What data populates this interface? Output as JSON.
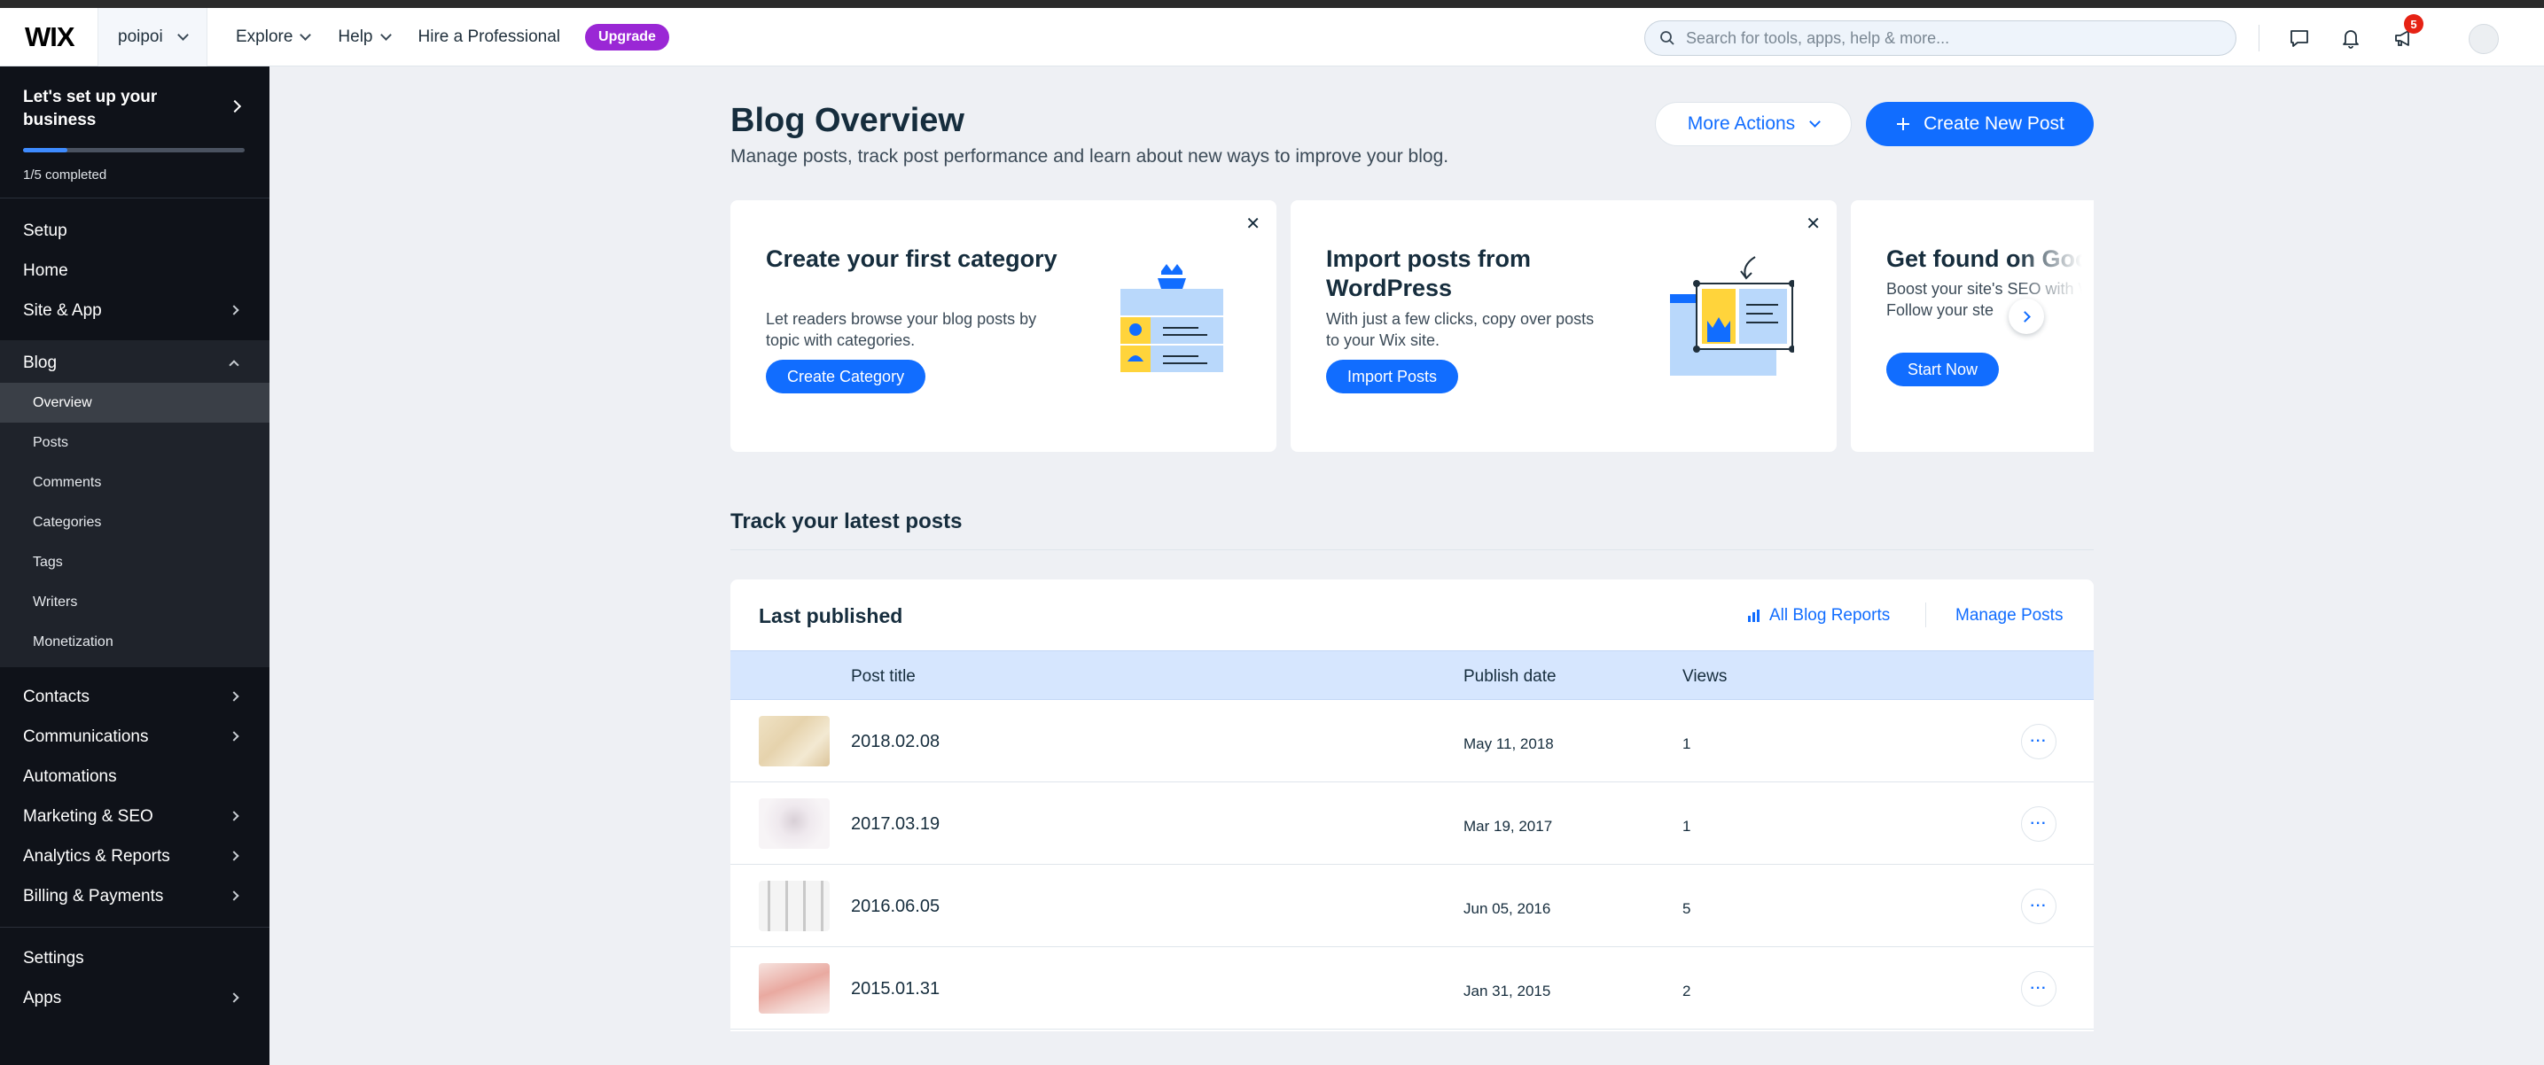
{
  "header": {
    "logo": "WIX",
    "site_name": "poipoi",
    "nav": [
      {
        "label": "Explore"
      },
      {
        "label": "Help"
      },
      {
        "label": "Hire a Professional"
      }
    ],
    "upgrade_label": "Upgrade",
    "search_placeholder": "Search for tools, apps, help & more...",
    "notification_badge": "5"
  },
  "sidebar": {
    "setup": {
      "title": "Let's set up your business",
      "progress": 0.2,
      "progress_text": "1/5 completed"
    },
    "top_items": [
      {
        "label": "Setup"
      },
      {
        "label": "Home"
      },
      {
        "label": "Site & App"
      }
    ],
    "blog": {
      "label": "Blog",
      "items": [
        {
          "label": "Overview"
        },
        {
          "label": "Posts"
        },
        {
          "label": "Comments"
        },
        {
          "label": "Categories"
        },
        {
          "label": "Tags"
        },
        {
          "label": "Writers"
        },
        {
          "label": "Monetization"
        }
      ]
    },
    "bottom_items": [
      {
        "label": "Contacts"
      },
      {
        "label": "Communications"
      },
      {
        "label": "Automations"
      },
      {
        "label": "Marketing & SEO"
      },
      {
        "label": "Analytics & Reports"
      },
      {
        "label": "Billing & Payments"
      }
    ],
    "footer_items": [
      {
        "label": "Settings"
      },
      {
        "label": "Apps"
      }
    ]
  },
  "main": {
    "title": "Blog Overview",
    "subtitle": "Manage posts, track post performance and learn about new ways to improve your blog.",
    "more_actions_label": "More Actions",
    "create_post_label": "Create New Post",
    "cards": [
      {
        "title": "Create your first category",
        "text": "Let readers browse your blog posts by topic with categories.",
        "button": "Create Category"
      },
      {
        "title": "Import posts from WordPress",
        "text": "With just a few clicks, copy over posts to your Wix site.",
        "button": "Import Posts"
      },
      {
        "title": "Get found on Goo",
        "text": "Boost your site's SEO with Wiz. Follow your ste",
        "button": "Start Now"
      }
    ],
    "section_title": "Track your latest posts",
    "table": {
      "title": "Last published",
      "reports_link": "All Blog Reports",
      "manage_link": "Manage Posts",
      "columns": [
        "Post title",
        "Publish date",
        "Views"
      ],
      "rows": [
        {
          "title": "2018.02.08",
          "date": "May 11, 2018",
          "views": "1"
        },
        {
          "title": "2017.03.19",
          "date": "Mar 19, 2017",
          "views": "1"
        },
        {
          "title": "2016.06.05",
          "date": "Jun 05, 2016",
          "views": "5"
        },
        {
          "title": "2015.01.31",
          "date": "Jan 31, 2015",
          "views": "2"
        }
      ]
    }
  },
  "colors": {
    "accent": "#116dff",
    "upgrade": "#9a27d5",
    "sidebar": "#0f1219",
    "badge": "#e62214"
  }
}
